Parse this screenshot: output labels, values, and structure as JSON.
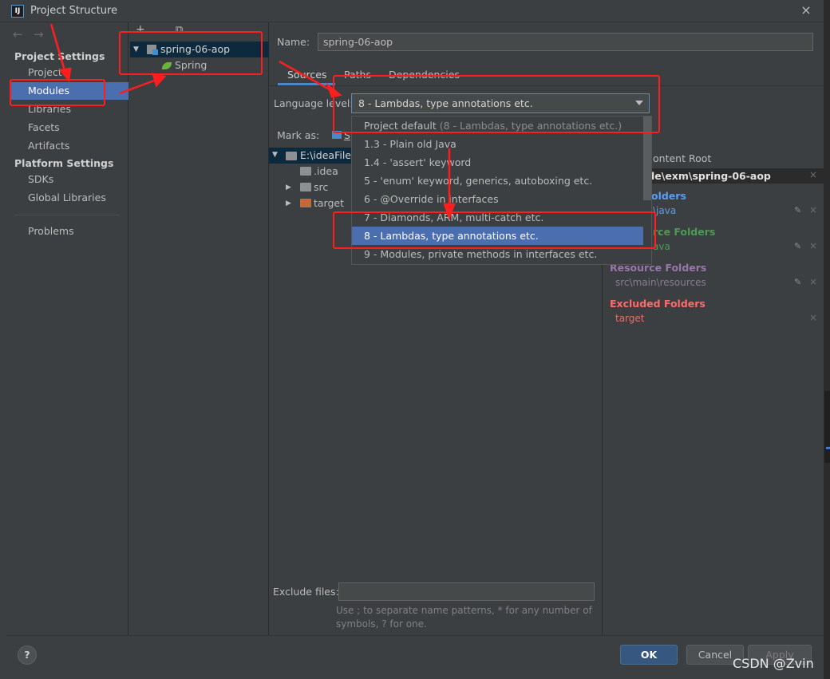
{
  "window": {
    "title": "Project Structure",
    "close_glyph": "×",
    "icon_text": "IJ"
  },
  "nav": {
    "back_glyph": "←",
    "forward_glyph": "→",
    "project_settings_header": "Project Settings",
    "project_items": [
      "Project",
      "Modules",
      "Libraries",
      "Facets",
      "Artifacts"
    ],
    "platform_settings_header": "Platform Settings",
    "platform_items": [
      "SDKs",
      "Global Libraries"
    ],
    "problems": "Problems"
  },
  "module_tree": {
    "add_glyph": "+",
    "copy_glyph": "⧉",
    "module_name": "spring-06-aop",
    "facet_name": "Spring"
  },
  "name_field": {
    "label": "Name:",
    "value": "spring-06-aop"
  },
  "tabs": [
    "Sources",
    "Paths",
    "Dependencies"
  ],
  "language_level": {
    "label": "Language level:",
    "selected": "8 - Lambdas, type annotations etc.",
    "options": [
      {
        "main": "Project default",
        "extra": "(8 - Lambdas, type annotations etc.)"
      },
      {
        "main": "1.3 - Plain old Java",
        "extra": ""
      },
      {
        "main": "1.4 - 'assert' keyword",
        "extra": ""
      },
      {
        "main": "5 - 'enum' keyword, generics, autoboxing etc.",
        "extra": ""
      },
      {
        "main": "6 - @Override in interfaces",
        "extra": ""
      },
      {
        "main": "7 - Diamonds, ARM, multi-catch etc.",
        "extra": ""
      },
      {
        "main": "8 - Lambdas, type annotations etc.",
        "extra": ""
      },
      {
        "main": "9 - Modules, private methods in interfaces etc.",
        "extra": ""
      }
    ],
    "selected_index": 6
  },
  "mark_as": {
    "label": "Mark as:",
    "partial": "S"
  },
  "source_tree": {
    "root": "E:\\ideaFile\\",
    "children": [
      ".idea",
      "src",
      "target"
    ]
  },
  "content_root": {
    "add_label": "ontent Root",
    "path": "le\\exm\\spring-06-aop",
    "sections": [
      {
        "title": "olders",
        "path": "\\java",
        "color": "#589df6"
      },
      {
        "title": "rce Folders",
        "path": "ava",
        "color": "#499c54"
      },
      {
        "title": "Resource Folders",
        "path": "src\\main\\resources",
        "color": "#9876aa"
      },
      {
        "title": "Excluded Folders",
        "path": "target",
        "color": "#ff6b68"
      }
    ]
  },
  "exclude": {
    "label": "Exclude files:",
    "value": "",
    "hint_line1": "Use ; to separate name patterns, * for any number of",
    "hint_line2": "symbols, ? for one."
  },
  "buttons": {
    "help": "?",
    "ok": "OK",
    "cancel": "Cancel",
    "apply": "Apply"
  },
  "watermark": "CSDN @Zvin",
  "colors": {
    "accent": "#4b6eaf",
    "annotation_red": "#ff1e1e",
    "ok_button": "#365880"
  }
}
